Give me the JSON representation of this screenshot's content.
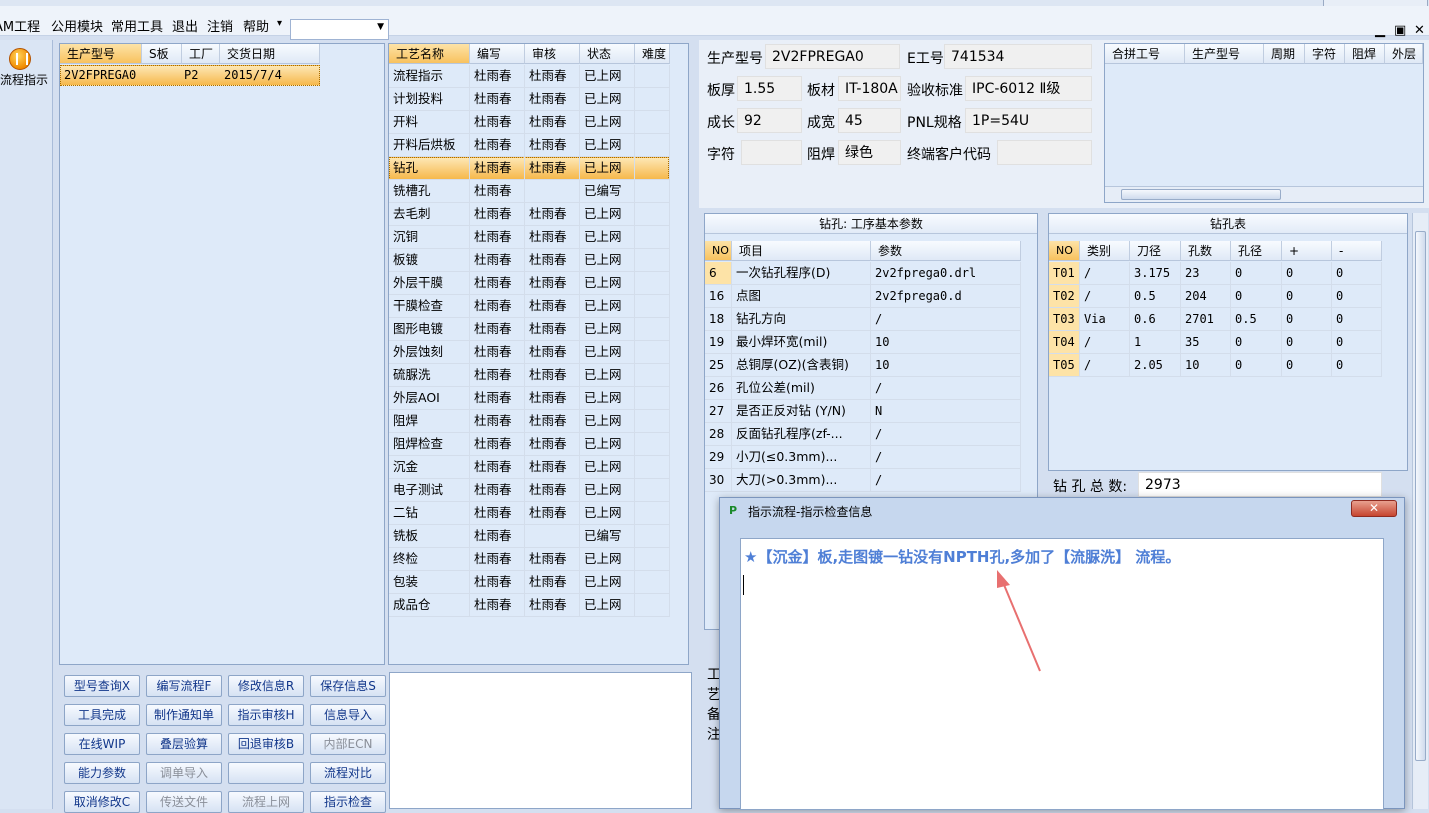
{
  "menubar": {
    "items": [
      "AM工程",
      "公用模块",
      "常用工具",
      "退出",
      "注销",
      "帮助"
    ],
    "help_arrow": "▾",
    "combo_value": "",
    "min": "▁",
    "restore": "▣",
    "close": "✕"
  },
  "leftstrip": {
    "label": "流程指示",
    "icon": "flow-indicator-icon"
  },
  "product_grid": {
    "headers": [
      "生产型号",
      "S板",
      "工厂",
      "交货日期"
    ],
    "row": [
      "2V2FPREGA0",
      "",
      "P2",
      "2015/7/4"
    ]
  },
  "process_grid": {
    "headers": [
      "工艺名称",
      "编写",
      "审核",
      "状态",
      "难度"
    ],
    "selected_index": 4,
    "rows": [
      [
        "流程指示",
        "杜雨春",
        "杜雨春",
        "已上网"
      ],
      [
        "计划投料",
        "杜雨春",
        "杜雨春",
        "已上网"
      ],
      [
        "开料",
        "杜雨春",
        "杜雨春",
        "已上网"
      ],
      [
        "开料后烘板",
        "杜雨春",
        "杜雨春",
        "已上网"
      ],
      [
        "钻孔",
        "杜雨春",
        "杜雨春",
        "已上网"
      ],
      [
        "铣槽孔",
        "杜雨春",
        "",
        "已编写"
      ],
      [
        "去毛刺",
        "杜雨春",
        "杜雨春",
        "已上网"
      ],
      [
        "沉铜",
        "杜雨春",
        "杜雨春",
        "已上网"
      ],
      [
        "板镀",
        "杜雨春",
        "杜雨春",
        "已上网"
      ],
      [
        "外层干膜",
        "杜雨春",
        "杜雨春",
        "已上网"
      ],
      [
        "干膜检查",
        "杜雨春",
        "杜雨春",
        "已上网"
      ],
      [
        "图形电镀",
        "杜雨春",
        "杜雨春",
        "已上网"
      ],
      [
        "外层蚀刻",
        "杜雨春",
        "杜雨春",
        "已上网"
      ],
      [
        "硫脲洗",
        "杜雨春",
        "杜雨春",
        "已上网"
      ],
      [
        "外层AOI",
        "杜雨春",
        "杜雨春",
        "已上网"
      ],
      [
        "阻焊",
        "杜雨春",
        "杜雨春",
        "已上网"
      ],
      [
        "阻焊检查",
        "杜雨春",
        "杜雨春",
        "已上网"
      ],
      [
        "沉金",
        "杜雨春",
        "杜雨春",
        "已上网"
      ],
      [
        "电子测试",
        "杜雨春",
        "杜雨春",
        "已上网"
      ],
      [
        "二钻",
        "杜雨春",
        "杜雨春",
        "已上网"
      ],
      [
        "铣板",
        "杜雨春",
        "",
        "已编写"
      ],
      [
        "终检",
        "杜雨春",
        "杜雨春",
        "已上网"
      ],
      [
        "包装",
        "杜雨春",
        "杜雨春",
        "已上网"
      ],
      [
        "成品仓",
        "杜雨春",
        "杜雨春",
        "已上网"
      ]
    ]
  },
  "buttons": [
    [
      "型号查询X",
      "编写流程F",
      "修改信息R",
      "保存信息S"
    ],
    [
      "工具完成",
      "制作通知单",
      "指示审核H",
      "信息导入"
    ],
    [
      "在线WIP",
      "叠层验算",
      "回退审核B",
      "内部ECN"
    ],
    [
      "能力参数",
      "调单导入",
      "",
      "流程对比"
    ],
    [
      "取消修改C",
      "传送文件",
      "流程上网",
      "指示检查"
    ]
  ],
  "disabled_buttons": [
    "内部ECN",
    "调单导入",
    "传送文件",
    "流程上网"
  ],
  "info": {
    "prod_label": "生产型号",
    "prod_value": "2V2FPREGA0",
    "e_label": "E工号",
    "e_value": "741534",
    "thick_label": "板厚",
    "thick_value": "1.55",
    "mat_label": "板材",
    "mat_value": "IT-180A",
    "std_label": "验收标准",
    "std_value": "IPC-6012 Ⅱ级",
    "len_label": "成长",
    "len_value": "92",
    "wid_label": "成宽",
    "wid_value": "45",
    "pnl_label": "PNL规格",
    "pnl_value": "1P=54U",
    "char_label": "字符",
    "char_value": "",
    "mask_label": "阻焊",
    "mask_value": "绿色",
    "cust_label": "终端客户代码",
    "cust_value": ""
  },
  "combine_grid": {
    "headers": [
      "合拼工号",
      "生产型号",
      "周期",
      "字符",
      "阻焊",
      "外层"
    ]
  },
  "drill_params": {
    "caption": "钻孔: 工序基本参数",
    "headers": [
      "NO",
      "项目",
      "参数"
    ],
    "rows": [
      [
        "6",
        "一次钻孔程序(D)",
        "2v2fprega0.drl"
      ],
      [
        "16",
        "点图",
        "2v2fprega0.d"
      ],
      [
        "18",
        "钻孔方向",
        "/"
      ],
      [
        "19",
        "最小焊环宽(mil)",
        "10"
      ],
      [
        "25",
        "总铜厚(OZ)(含表铜)",
        "10"
      ],
      [
        "26",
        "孔位公差(mil)",
        "/"
      ],
      [
        "27",
        "是否正反对钻 (Y/N)",
        "N"
      ],
      [
        "28",
        "反面钻孔程序(zf-...",
        "/"
      ],
      [
        "29",
        "小刀(≤0.3mm)...",
        "/"
      ],
      [
        "30",
        "大刀(>0.3mm)...",
        "/"
      ]
    ]
  },
  "drill_table": {
    "caption": "钻孔表",
    "headers": [
      "NO",
      "类别",
      "刀径",
      "孔数",
      "孔径",
      "+",
      "-"
    ],
    "rows": [
      [
        "T01",
        "/",
        "3.175",
        "23",
        "0",
        "0",
        "0"
      ],
      [
        "T02",
        "/",
        "0.5",
        "204",
        "0",
        "0",
        "0"
      ],
      [
        "T03",
        "Via",
        "0.6",
        "2701",
        "0.5",
        "0",
        "0"
      ],
      [
        "T04",
        "/",
        "1",
        "35",
        "0",
        "0",
        "0"
      ],
      [
        "T05",
        "/",
        "2.05",
        "10",
        "0",
        "0",
        "0"
      ]
    ],
    "total_label": "钻 孔 总 数:",
    "total_value": "2973"
  },
  "side_labels": [
    "工",
    "艺",
    "备",
    "注"
  ],
  "dialog": {
    "title": "指示流程-指示检查信息",
    "close": "✕",
    "message": "★【沉金】板,走图镀一钻没有NPTH孔,多加了【流脲洗】 流程。"
  },
  "colors": {
    "accent": "#f8c25f",
    "message": "#4f7fd6",
    "arrow": "#e87070"
  }
}
